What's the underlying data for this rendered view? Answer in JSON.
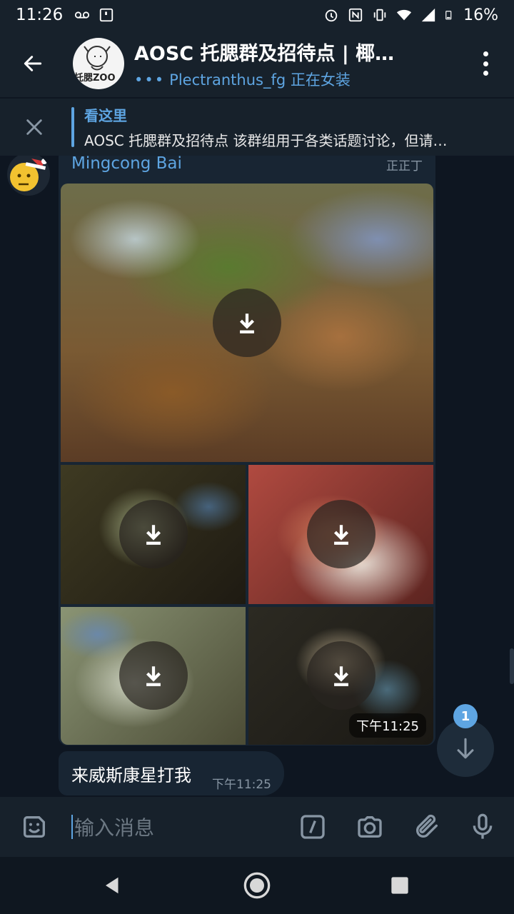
{
  "status_bar": {
    "time": "11:26",
    "battery": "16%"
  },
  "header": {
    "title": "AOSC 托腮群及招待点 | 椰…",
    "avatar_text": "托腮ZOO",
    "status_dots": "•••",
    "status": "Plectranthus_fg 正在女装"
  },
  "pinned": {
    "title": "看这里",
    "body": "AOSC 托腮群及招待点  该群组用于各类话题讨论，但请…"
  },
  "messages": [
    {
      "sender": "Mingcong Bai",
      "forwarded_tag": "正正丁",
      "media_count": 5,
      "time": "下午11:25"
    },
    {
      "text": "来威斯康星打我",
      "time": "下午11:25"
    }
  ],
  "scroll": {
    "unread_count": "1"
  },
  "input": {
    "placeholder": "输入消息"
  },
  "colors": {
    "accent": "#5ea5e2",
    "header_bg": "#17212b",
    "chat_bg": "#0e1621",
    "bubble_bg": "#182533"
  },
  "icons": {
    "status": [
      "voicemail-icon",
      "screenshot-icon",
      "alarm-icon",
      "nfc-icon",
      "vibrate-icon",
      "wifi-icon",
      "signal-icon",
      "battery-icon"
    ],
    "header": [
      "back-arrow-icon",
      "more-vertical-icon"
    ],
    "input": [
      "sticker-icon",
      "slash-command-icon",
      "camera-icon",
      "attach-icon",
      "mic-icon"
    ],
    "nav": [
      "back-triangle-icon",
      "home-circle-icon",
      "recents-square-icon"
    ]
  }
}
